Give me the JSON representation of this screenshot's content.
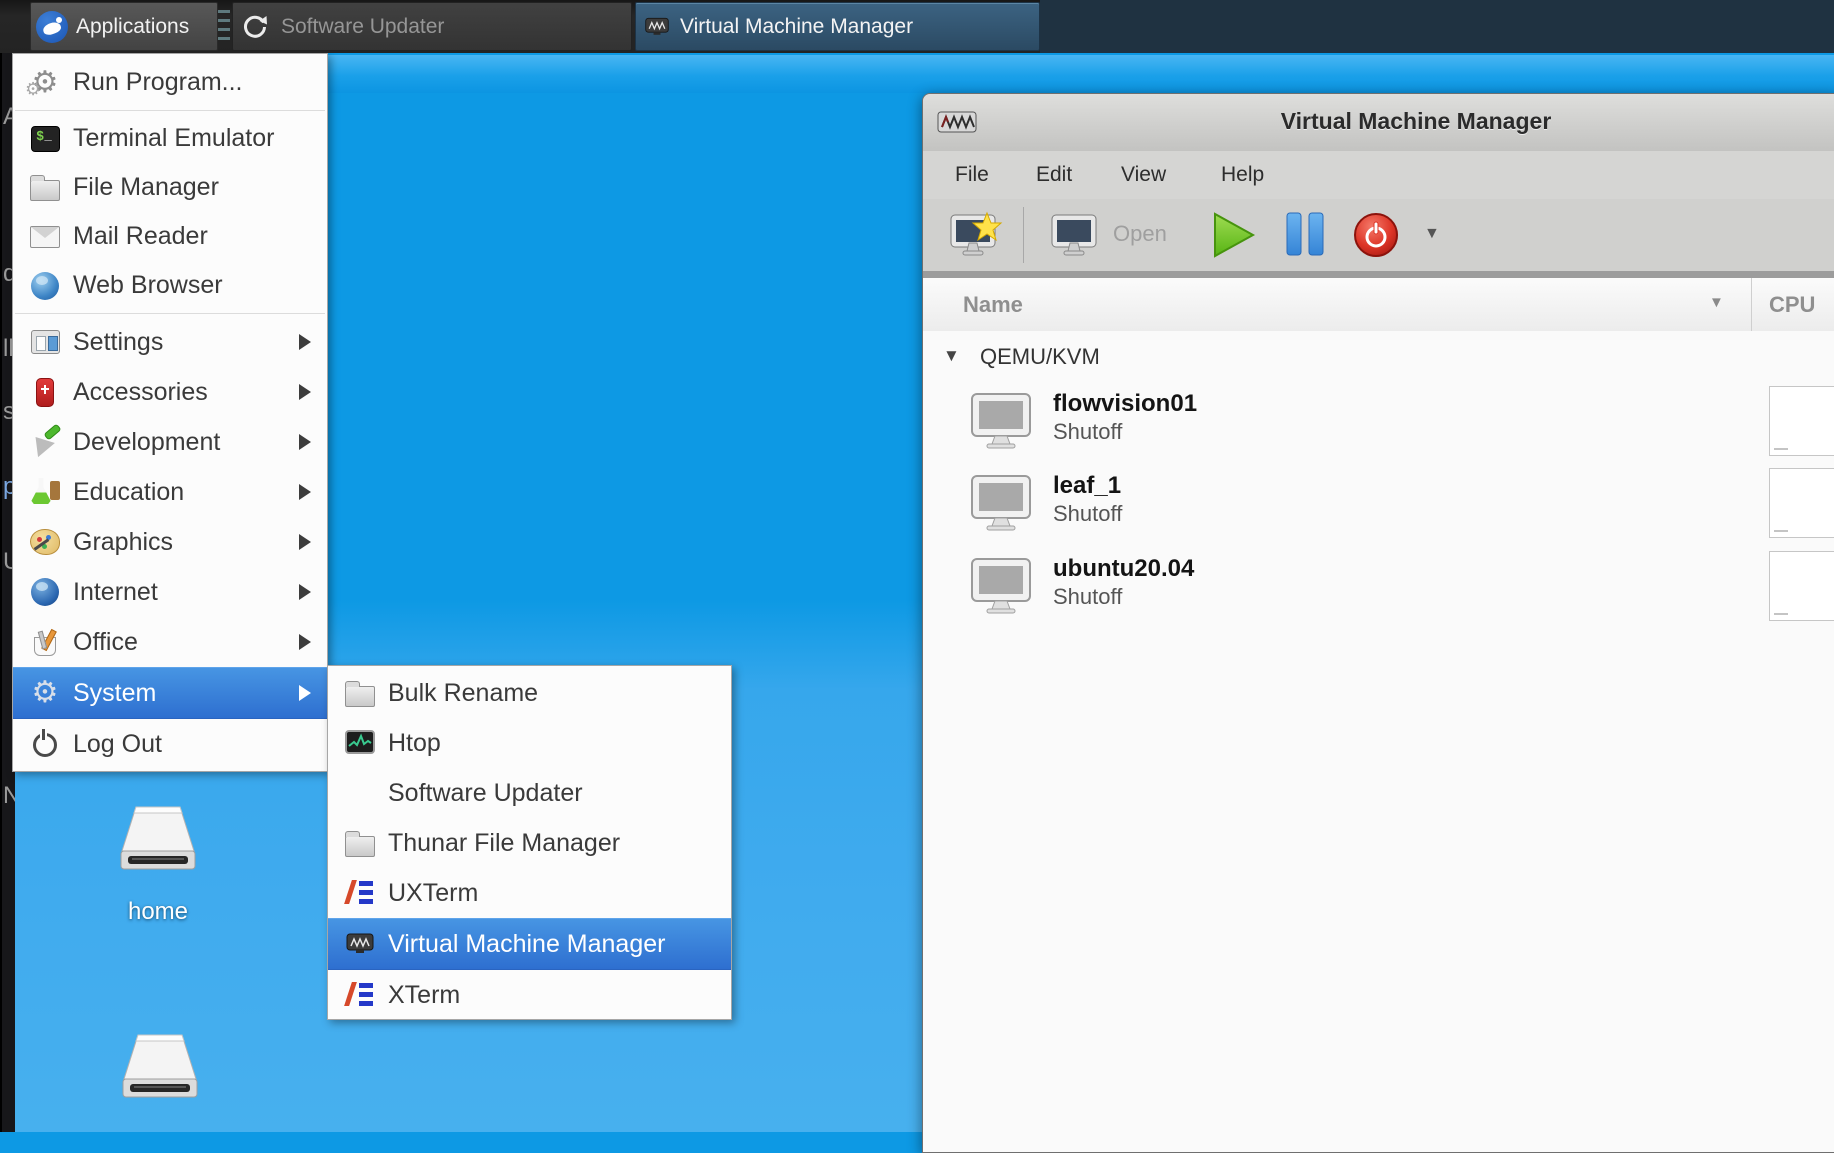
{
  "panel": {
    "applications_label": "Applications",
    "tasks": [
      {
        "label": "Software Updater",
        "active": false
      },
      {
        "label": "Virtual Machine Manager",
        "active": true
      }
    ]
  },
  "background_fragments": [
    "A",
    "d",
    "ll",
    "s",
    "p",
    "U",
    "N"
  ],
  "menu": {
    "items": [
      {
        "label": "Run Program...",
        "icon": "gears-icon"
      },
      {
        "label": "Terminal Emulator",
        "icon": "terminal-icon"
      },
      {
        "label": "File Manager",
        "icon": "folder-icon"
      },
      {
        "label": "Mail Reader",
        "icon": "mail-icon"
      },
      {
        "label": "Web Browser",
        "icon": "globe-icon"
      },
      {
        "label": "Settings",
        "icon": "settings-icon",
        "submenu": true
      },
      {
        "label": "Accessories",
        "icon": "swiss-knife-icon",
        "submenu": true
      },
      {
        "label": "Development",
        "icon": "trowel-icon",
        "submenu": true
      },
      {
        "label": "Education",
        "icon": "flask-icon",
        "submenu": true
      },
      {
        "label": "Graphics",
        "icon": "palette-icon",
        "submenu": true
      },
      {
        "label": "Internet",
        "icon": "globe-icon",
        "submenu": true
      },
      {
        "label": "Office",
        "icon": "cup-icon",
        "submenu": true
      },
      {
        "label": "System",
        "icon": "gear-icon",
        "submenu": true,
        "highlighted": true
      },
      {
        "label": "Log Out",
        "icon": "power-icon"
      }
    ]
  },
  "submenu": {
    "items": [
      {
        "label": "Bulk Rename",
        "icon": "folder-icon"
      },
      {
        "label": "Htop",
        "icon": "htop-icon"
      },
      {
        "label": "Software Updater",
        "icon": "none"
      },
      {
        "label": "Thunar File Manager",
        "icon": "folder-icon"
      },
      {
        "label": "UXTerm",
        "icon": "xterm-icon"
      },
      {
        "label": "Virtual Machine Manager",
        "icon": "vmm-icon",
        "highlighted": true
      },
      {
        "label": "XTerm",
        "icon": "xterm-icon"
      }
    ]
  },
  "desktop": {
    "icons": [
      {
        "label": "home"
      },
      {
        "label": ""
      }
    ]
  },
  "vmm_window": {
    "title": "Virtual Machine Manager",
    "menubar": [
      "File",
      "Edit",
      "View",
      "Help"
    ],
    "toolbar": {
      "open_label": "Open"
    },
    "columns": {
      "name": "Name",
      "cpu": "CPU"
    },
    "tree_root": "QEMU/KVM",
    "vms": [
      {
        "name": "flowvision01",
        "status": "Shutoff"
      },
      {
        "name": "leaf_1",
        "status": "Shutoff"
      },
      {
        "name": "ubuntu20.04",
        "status": "Shutoff"
      }
    ]
  },
  "glyphs": {
    "gear": "⚙",
    "caret_down": "▼",
    "expander_open": "▼"
  },
  "colors": {
    "selection_blue_top": "#4795e3",
    "selection_blue_bottom": "#2e6fd0",
    "desktop_blue": "#0d99e4",
    "panel_dark": "#232323",
    "panel_navy": "#1f3241",
    "active_task_blue": "#2b4a63",
    "play_green": "#65bd1f",
    "pause_blue": "#4a9ce8",
    "power_red": "#d8352a",
    "star_yellow": "#ffe24a"
  }
}
